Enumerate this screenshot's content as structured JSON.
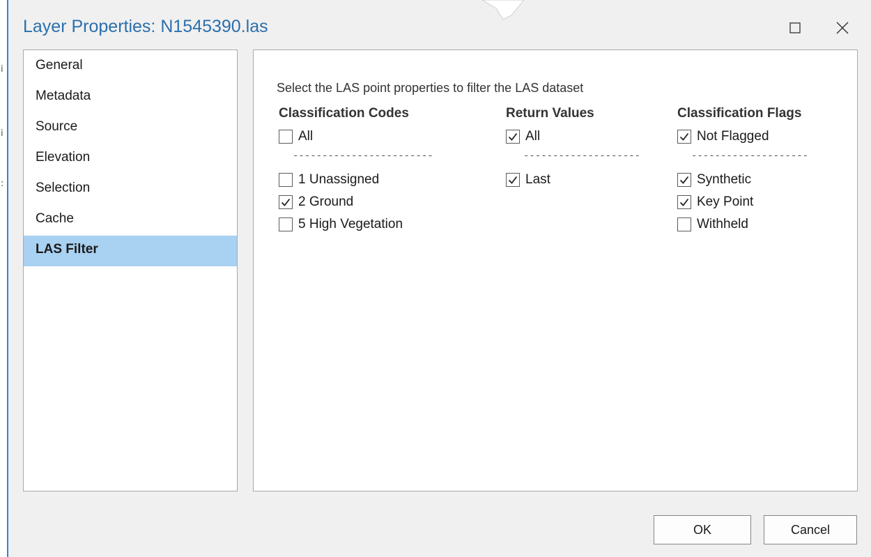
{
  "window": {
    "title": "Layer Properties: N1545390.las"
  },
  "nav": {
    "items": [
      {
        "label": "General",
        "selected": false
      },
      {
        "label": "Metadata",
        "selected": false
      },
      {
        "label": "Source",
        "selected": false
      },
      {
        "label": "Elevation",
        "selected": false
      },
      {
        "label": "Selection",
        "selected": false
      },
      {
        "label": "Cache",
        "selected": false
      },
      {
        "label": "LAS Filter",
        "selected": true
      }
    ]
  },
  "filter": {
    "instruction": "Select the LAS point properties to filter the LAS dataset",
    "classification_codes": {
      "header": "Classification Codes",
      "all": {
        "label": "All",
        "checked": false
      },
      "separator": "------------------------",
      "items": [
        {
          "label": "1 Unassigned",
          "checked": false
        },
        {
          "label": "2 Ground",
          "checked": true
        },
        {
          "label": "5 High Vegetation",
          "checked": false
        }
      ]
    },
    "return_values": {
      "header": "Return Values",
      "all": {
        "label": "All",
        "checked": true
      },
      "separator": "--------------------",
      "items": [
        {
          "label": "Last",
          "checked": true
        }
      ]
    },
    "classification_flags": {
      "header": "Classification Flags",
      "not_flagged": {
        "label": "Not Flagged",
        "checked": true
      },
      "separator": "--------------------",
      "items": [
        {
          "label": "Synthetic",
          "checked": true
        },
        {
          "label": "Key Point",
          "checked": true
        },
        {
          "label": "Withheld",
          "checked": false
        }
      ]
    }
  },
  "buttons": {
    "ok_label": "OK",
    "cancel_label": "Cancel"
  },
  "colors": {
    "title": "#2b6fad",
    "selected_nav": "#a9d1f1",
    "border": "#a9a9a9"
  }
}
